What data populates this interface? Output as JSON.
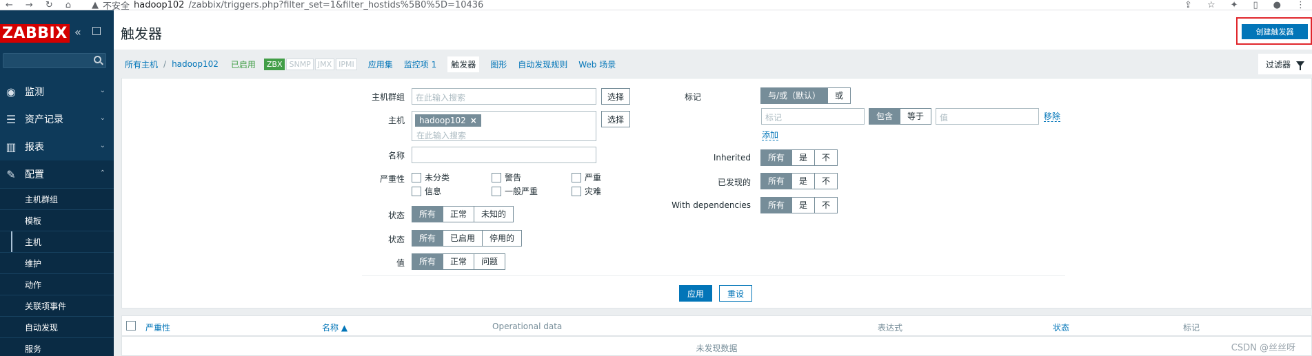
{
  "browser": {
    "security_label": "不安全",
    "url_host": "hadoop102",
    "url_path": "/zabbix/triggers.php?filter_set=1&filter_hostids%5B0%5D=10436"
  },
  "sidebar": {
    "logo": "ZABBIX",
    "menu": [
      {
        "label": "监测",
        "icon": "eye-icon"
      },
      {
        "label": "资产记录",
        "icon": "list-icon"
      },
      {
        "label": "报表",
        "icon": "bar-chart-icon"
      },
      {
        "label": "配置",
        "icon": "wrench-icon"
      }
    ],
    "submenu": [
      "主机群组",
      "模板",
      "主机",
      "维护",
      "动作",
      "关联项事件",
      "自动发现",
      "服务"
    ]
  },
  "header": {
    "title": "触发器",
    "create_button": "创建触发器"
  },
  "nav": {
    "all_hosts": "所有主机",
    "host": "hadoop102",
    "status": "已启用",
    "badges": [
      "ZBX",
      "SNMP",
      "JMX",
      "IPMI"
    ],
    "tabs": [
      "应用集",
      "监控项 1",
      "触发器",
      "图形",
      "自动发现规则",
      "Web 场景"
    ],
    "filter_tab": "过滤器"
  },
  "filter": {
    "host_group_label": "主机群组",
    "host_group_placeholder": "在此输入搜索",
    "select_button": "选择",
    "host_label": "主机",
    "host_chip": "hadoop102",
    "host_placeholder": "在此输入搜索",
    "name_label": "名称",
    "name_value": "",
    "severity_label": "严重性",
    "severities": [
      "未分类",
      "警告",
      "严重",
      "信息",
      "一般严重",
      "灾难"
    ],
    "state_label": "状态",
    "state_options": [
      "所有",
      "正常",
      "未知的"
    ],
    "status_label": "状态",
    "status_options": [
      "所有",
      "已启用",
      "停用的"
    ],
    "value_label": "值",
    "value_options": [
      "所有",
      "正常",
      "问题"
    ],
    "tags_label": "标记",
    "tags_eval_options": [
      "与/或（默认）",
      "或"
    ],
    "tag_placeholder": "标记",
    "tag_op_options": [
      "包含",
      "等于"
    ],
    "tag_value_placeholder": "值",
    "remove_link": "移除",
    "add_link": "添加",
    "inherited_label": "Inherited",
    "discovered_label": "已发现的",
    "dependencies_label": "With dependencies",
    "tri_options": [
      "所有",
      "是",
      "不"
    ],
    "apply_button": "应用",
    "reset_button": "重设"
  },
  "table": {
    "columns": [
      "严重性",
      "名称 ▲",
      "Operational data",
      "表达式",
      "状态",
      "标记"
    ],
    "no_data": "未发现数据"
  },
  "watermark": "CSDN @丝丝呀"
}
